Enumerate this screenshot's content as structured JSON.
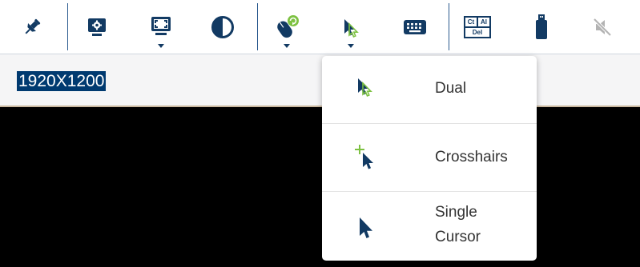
{
  "toolbar": {
    "buttons": [
      {
        "name": "pin",
        "icon": "pin-icon"
      },
      {
        "name": "settings-display",
        "icon": "monitor-gear-icon"
      },
      {
        "name": "fullscreen",
        "icon": "fullscreen-monitor-icon",
        "has_dropdown": true
      },
      {
        "name": "contrast",
        "icon": "contrast-icon"
      },
      {
        "name": "mouse-sync",
        "icon": "mouse-sync-icon",
        "has_dropdown": true
      },
      {
        "name": "cursor-mode",
        "icon": "cursor-icon",
        "has_dropdown": true
      },
      {
        "name": "keyboard",
        "icon": "keyboard-icon"
      },
      {
        "name": "ctrl-alt-del",
        "icon": "ctrl-alt-del-icon",
        "key_labels": [
          "Ct",
          "Al",
          "Del"
        ]
      },
      {
        "name": "usb",
        "icon": "usb-icon"
      },
      {
        "name": "mute",
        "icon": "mute-icon"
      }
    ]
  },
  "resolution": {
    "text": "1920X1200"
  },
  "cursor_menu": {
    "items": [
      {
        "label": "Dual",
        "icon": "dual-cursor-icon"
      },
      {
        "label": "Crosshairs",
        "icon": "crosshairs-cursor-icon"
      },
      {
        "label_line1": "Single",
        "label_line2": "Cursor",
        "icon": "single-cursor-icon"
      }
    ]
  },
  "colors": {
    "primary": "#123a63",
    "accent_green": "#7dc142",
    "selection_bg": "#003a70",
    "muted_icon": "#b3b3b3"
  }
}
